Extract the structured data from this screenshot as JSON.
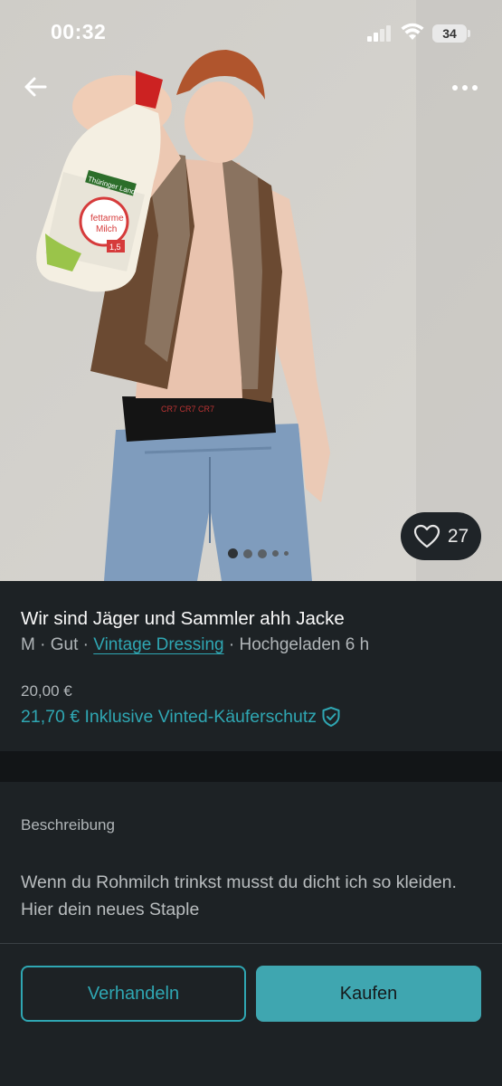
{
  "status_bar": {
    "time": "00:32",
    "battery": "34"
  },
  "photo": {
    "description_icon": "product-photo",
    "image_count": 5,
    "active_index": 0,
    "bottle_brand": "Thüringer Land",
    "bottle_label": "frische fettarme Milch",
    "bottle_fat": "1,5"
  },
  "likes": {
    "count": "27",
    "icon": "heart-icon"
  },
  "item": {
    "title": "Wir sind Jäger und Sammler ahh Jacke",
    "size": "M",
    "separator": " · ",
    "condition": "Gut",
    "seller": "Vintage Dressing",
    "uploaded": "Hochgeladen 6 h",
    "price": "20,00 €",
    "price_with_protection": "21,70 € Inklusive Vinted-Käuferschutz",
    "protection_icon": "shield-check-icon"
  },
  "description": {
    "label": "Beschreibung",
    "text": "Wenn du Rohmilch trinkst musst du dicht ich so kleiden. Hier dein neues Staple"
  },
  "actions": {
    "negotiate": "Verhandeln",
    "buy": "Kaufen"
  },
  "colors": {
    "accent": "#2fa7b3",
    "background": "#1d2225",
    "buy_button": "#3fa6b0"
  }
}
